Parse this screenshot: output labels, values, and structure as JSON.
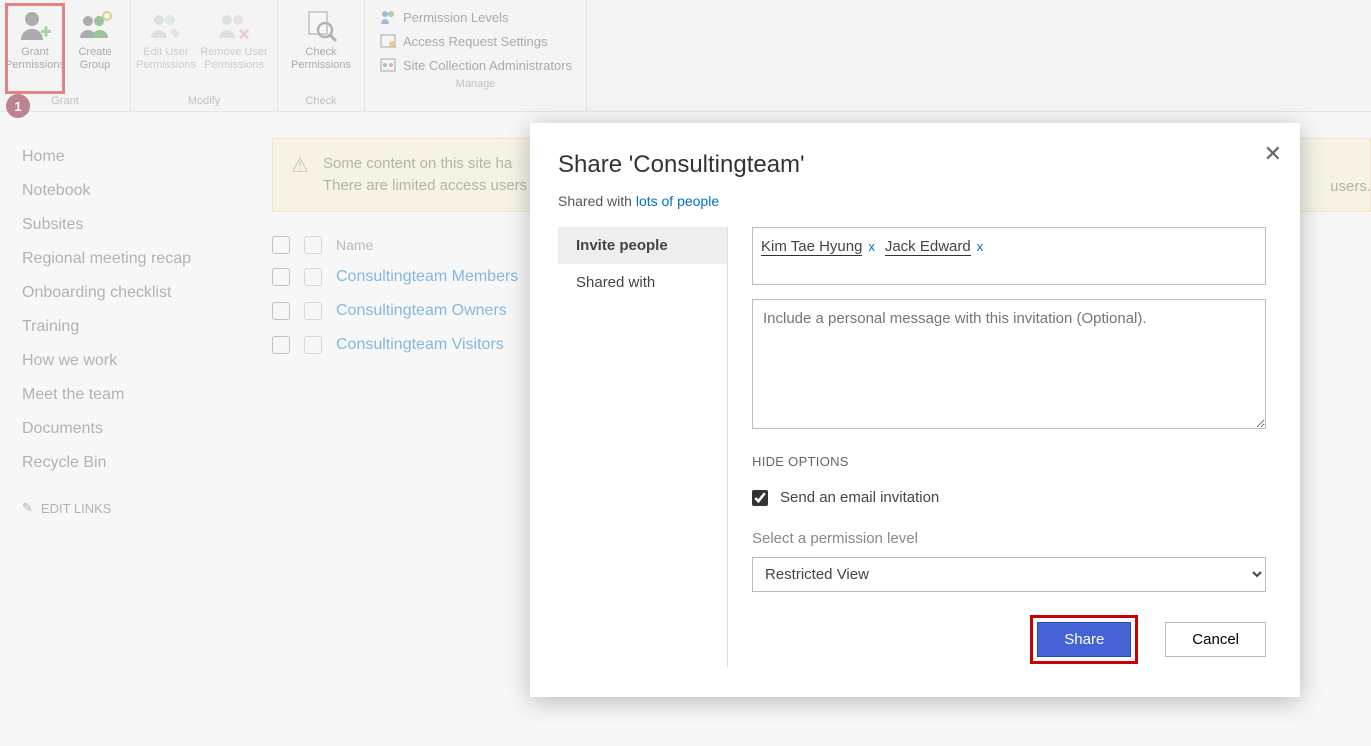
{
  "ribbon": {
    "grant": {
      "label": "Grant\nPermissions",
      "group": "Grant"
    },
    "create_group": {
      "label": "Create\nGroup"
    },
    "edit_user": {
      "label": "Edit User\nPermissions"
    },
    "remove_user": {
      "label": "Remove User\nPermissions"
    },
    "modify_group": "Modify",
    "check": {
      "label": "Check\nPermissions",
      "group": "Check"
    },
    "manage": {
      "permission_levels": "Permission Levels",
      "access_request": "Access Request Settings",
      "site_collection_admins": "Site Collection Administrators",
      "group": "Manage"
    }
  },
  "badge": "1",
  "nav": {
    "items": [
      "Home",
      "Notebook",
      "Subsites",
      "Regional meeting recap",
      "Onboarding checklist",
      "Training",
      "How we work",
      "Meet the team",
      "Documents",
      "Recycle Bin"
    ],
    "edit_links": "EDIT LINKS"
  },
  "msgbar": {
    "line1": "Some content on this site ha",
    "line2": "There are limited access users on t",
    "tail": "users."
  },
  "list": {
    "col_name": "Name",
    "rows": [
      "Consultingteam Members",
      "Consultingteam Owners",
      "Consultingteam Visitors"
    ]
  },
  "dialog": {
    "title": "Share 'Consultingteam'",
    "shared_prefix": "Shared with ",
    "shared_link": "lots of people",
    "tabs": {
      "invite": "Invite people",
      "shared_with": "Shared with"
    },
    "people": [
      {
        "name": "Kim Tae Hyung"
      },
      {
        "name": "Jack Edward"
      }
    ],
    "msg_placeholder": "Include a personal message with this invitation (Optional).",
    "hide_options": "HIDE OPTIONS",
    "send_email": "Send an email invitation",
    "perm_label": "Select a permission level",
    "perm_value": "Restricted View",
    "share": "Share",
    "cancel": "Cancel"
  }
}
